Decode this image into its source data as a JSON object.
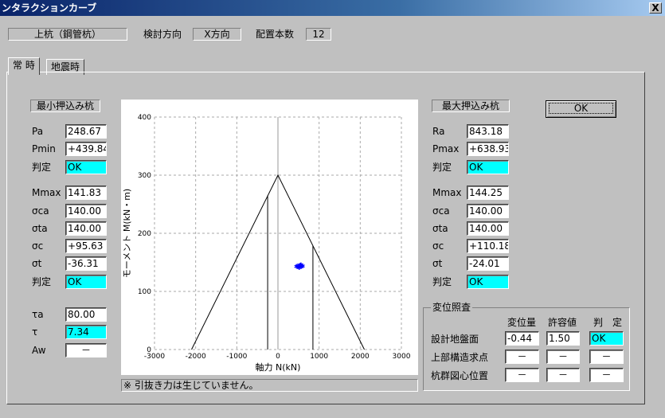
{
  "window": {
    "title": "ンタラクションカーブ",
    "close_label": "X"
  },
  "header": {
    "pile_type": "上杭（鋼管杭）",
    "direction_label": "検討方向",
    "direction_value": "X方向",
    "count_label": "配置本数",
    "count_value": "12"
  },
  "tabs": [
    {
      "label": "常 時"
    },
    {
      "label": "地震時"
    }
  ],
  "left_panel": {
    "title": "最小押込み杭",
    "rows": [
      {
        "label": "Pa",
        "value": "248.67"
      },
      {
        "label": "Pmin",
        "value": "+439.84"
      },
      {
        "label": "判定",
        "value": "OK"
      },
      {
        "label": "Mmax",
        "value": "141.83"
      },
      {
        "label": "σca",
        "value": "140.00"
      },
      {
        "label": "σta",
        "value": "140.00"
      },
      {
        "label": "σc",
        "value": "+95.63"
      },
      {
        "label": "σt",
        "value": "-36.31"
      },
      {
        "label": "判定",
        "value": "OK"
      },
      {
        "label": "τa",
        "value": "80.00"
      },
      {
        "label": "τ",
        "value": "7.34"
      },
      {
        "label": "Aw",
        "value": "－"
      }
    ]
  },
  "right_panel": {
    "title": "最大押込み杭",
    "rows": [
      {
        "label": "Ra",
        "value": "843.18"
      },
      {
        "label": "Pmax",
        "value": "+638.93"
      },
      {
        "label": "判定",
        "value": "OK"
      },
      {
        "label": "Mmax",
        "value": "144.25"
      },
      {
        "label": "σca",
        "value": "140.00"
      },
      {
        "label": "σta",
        "value": "140.00"
      },
      {
        "label": "σc",
        "value": "+110.18"
      },
      {
        "label": "σt",
        "value": "-24.01"
      },
      {
        "label": "判定",
        "value": "OK"
      }
    ]
  },
  "ok_button": {
    "label": "OK"
  },
  "displacement": {
    "legend": "変位照査",
    "col_disp": "変位量",
    "col_allow": "許容値",
    "col_judge": "判　定",
    "rows": [
      {
        "label": "設計地盤面",
        "disp": "-0.44",
        "allow": "1.50",
        "judge": "OK"
      },
      {
        "label": "上部構造求点",
        "disp": "－",
        "allow": "－",
        "judge": "－"
      },
      {
        "label": "杭群図心位置",
        "disp": "－",
        "allow": "－",
        "judge": "－"
      }
    ]
  },
  "note": "※ 引抜き力は生じていません。",
  "colors": {
    "ok_bg": "#00ffff",
    "point_color": "#0000ff",
    "face": "#c0c0c0"
  },
  "chart_data": {
    "type": "line",
    "xlabel": "軸力 N(kN)",
    "ylabel": "モーメント M(kN・m)",
    "xlim": [
      -3000,
      3000
    ],
    "ylim": [
      0,
      400
    ],
    "x_ticks": [
      "-3000",
      "-2000",
      "-1000",
      "0",
      "1000",
      "2000",
      "3000"
    ],
    "y_ticks": [
      "0",
      "100",
      "200",
      "300",
      "400"
    ],
    "grid": true,
    "series": [
      {
        "values": [
          [
            -2100,
            0
          ],
          [
            0,
            300
          ],
          [
            2100,
            0
          ]
        ]
      },
      {
        "values": [
          [
            -250,
            0
          ],
          [
            -250,
            265
          ]
        ]
      },
      {
        "values": [
          [
            850,
            0
          ],
          [
            850,
            178
          ]
        ]
      }
    ],
    "points": [
      [
        450,
        143
      ],
      [
        480,
        144
      ],
      [
        510,
        142
      ],
      [
        540,
        145
      ],
      [
        570,
        143
      ],
      [
        600,
        144
      ],
      [
        520,
        141
      ],
      [
        560,
        146
      ]
    ]
  }
}
